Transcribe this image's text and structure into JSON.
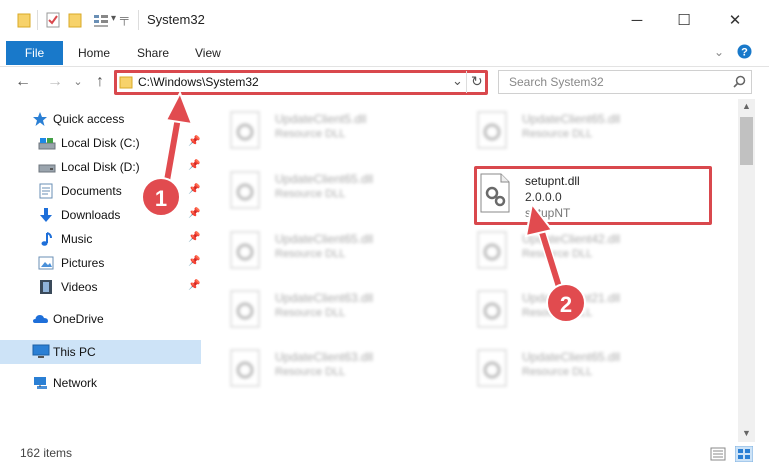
{
  "window": {
    "title": "System32",
    "minimize": "─",
    "maximize": "☐",
    "close": "✕"
  },
  "ribbon": {
    "tabs": [
      {
        "label": "File"
      },
      {
        "label": "Home"
      },
      {
        "label": "Share"
      },
      {
        "label": "View"
      }
    ]
  },
  "nav": {
    "back": "←",
    "forward": "→",
    "recent": "⌄",
    "up": "↑"
  },
  "address": {
    "path": "C:\\Windows\\System32",
    "dropdown": "⌄",
    "refresh": "↻"
  },
  "search": {
    "placeholder": "Search System32"
  },
  "sidebar": {
    "items": [
      {
        "label": "Quick access"
      },
      {
        "label": "Local Disk (C:)"
      },
      {
        "label": "Local Disk (D:)"
      },
      {
        "label": "Documents"
      },
      {
        "label": "Downloads"
      },
      {
        "label": "Music"
      },
      {
        "label": "Pictures"
      },
      {
        "label": "Videos"
      },
      {
        "label": "OneDrive"
      },
      {
        "label": "This PC"
      },
      {
        "label": "Network"
      }
    ]
  },
  "files": [
    {
      "name": "UpdateClient5.dll",
      "desc": "Resource DLL"
    },
    {
      "name": "UpdateClient65.dll",
      "desc": "Resource DLL"
    },
    {
      "name": "UpdateClient65.dll",
      "desc": "Resource DLL"
    },
    {
      "name": "setupnt.dll",
      "version": "2.0.0.0",
      "desc": "setupNT"
    },
    {
      "name": "UpdateClient65.dll",
      "desc": "Resource DLL"
    },
    {
      "name": "UpdateClient42.dll",
      "desc": "Resource DLL"
    },
    {
      "name": "UpdateClient63.dll",
      "desc": "Resource DLL"
    },
    {
      "name": "UpdateClient21.dll",
      "desc": "Resource DLL"
    },
    {
      "name": "UpdateClient63.dll",
      "desc": "Resource DLL"
    },
    {
      "name": "UpdateClient65.dll",
      "desc": "Resource DLL"
    }
  ],
  "annotations": {
    "step1": "1",
    "step2": "2"
  },
  "status": {
    "count": "162 items"
  },
  "colors": {
    "accent": "#1979ca",
    "highlight": "#d9484d"
  }
}
